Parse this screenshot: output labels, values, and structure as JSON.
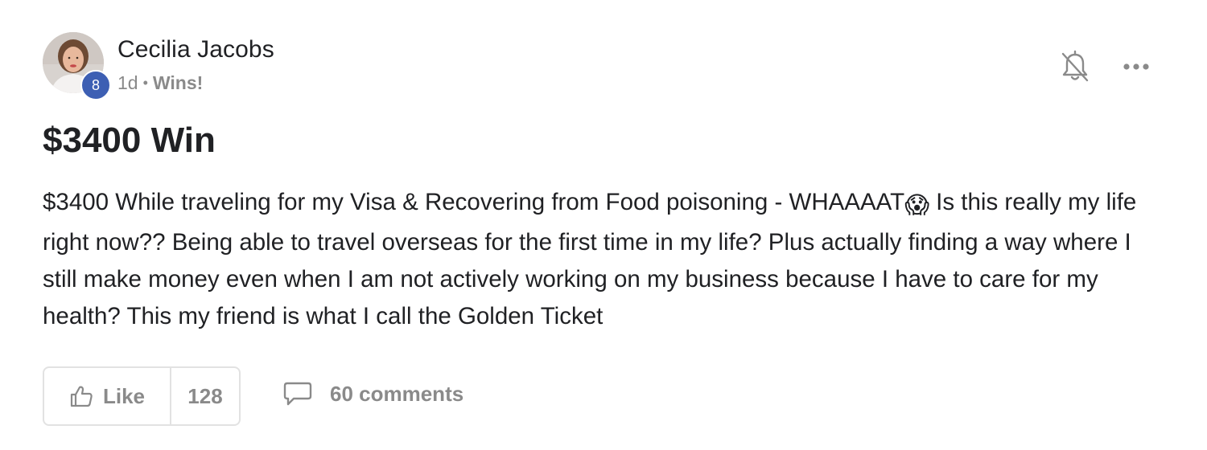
{
  "post": {
    "author": {
      "name": "Cecilia Jacobs",
      "level": "8",
      "avatar_icon": "user-avatar-photo"
    },
    "meta": {
      "time_ago": "1d",
      "separator": "•",
      "category": "Wins!"
    },
    "actions": {
      "notifications_icon": "bell-off-icon",
      "more_icon": "more-horizontal-icon"
    },
    "title": "$3400 Win",
    "body_before_emoji": "$3400 While traveling for my Visa & Recovering from Food poisoning - WHAAAAT",
    "body_emoji": "😱",
    "body_after_emoji": " Is this really my life right now?? Being able to travel overseas for the first time in my life? Plus actually finding a way where I still make money even when I am not actively working on my business because I have to care for my health? This my friend is what I call the Golden Ticket",
    "footer": {
      "like_label": "Like",
      "like_count": "128",
      "comments_label": "60 comments",
      "like_icon": "thumbs-up-icon",
      "comment_icon": "speech-bubble-icon"
    },
    "colors": {
      "text_primary": "#202124",
      "text_muted": "#8a8a8a",
      "badge": "#3d5fb3",
      "border": "#e2e2e2"
    }
  }
}
